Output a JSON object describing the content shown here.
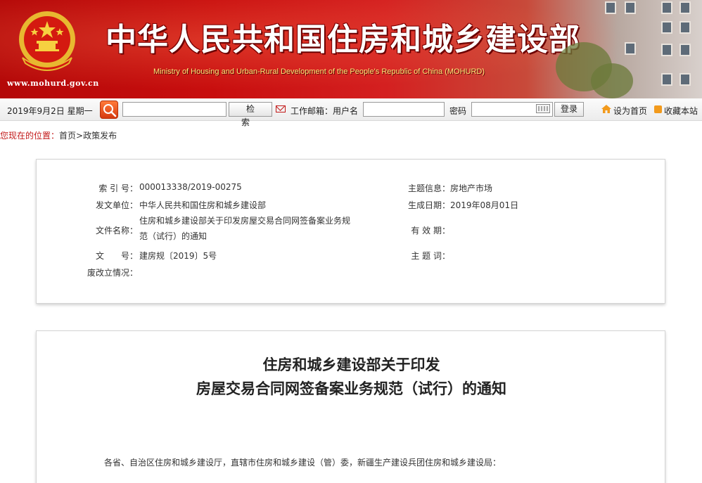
{
  "banner": {
    "cn_title": "中华人民共和国住房和城乡建设部",
    "en_title": "Ministry of Housing and Urban-Rural Development of the People's Republic of China (MOHURD)",
    "site_url": "www.mohurd.gov.cn"
  },
  "toolbar": {
    "date": "2019年9月2日  星期一",
    "search_value": "",
    "search_button": "检索",
    "mail_label": "工作邮箱：用户名",
    "username_value": "",
    "password_label": "密码",
    "password_value": "",
    "login_button": "登录",
    "set_home": "设为首页",
    "add_favorite": "收藏本站"
  },
  "breadcrumb": {
    "label": "您现在的位置：",
    "home": "首页",
    "sep": ">",
    "section": "政策发布"
  },
  "info": {
    "index_label": "索 引 号：",
    "index_value": "000013338/2019-00275",
    "topic_label": "主题信息：",
    "topic_value": "房地产市场",
    "issuer_label": "发文单位：",
    "issuer_value": "中华人民共和国住房和城乡建设部",
    "date_label": "生成日期：",
    "date_value": "2019年08月01日",
    "doc_name_label": "文件名称：",
    "doc_name_value": "住房和城乡建设部关于印发房屋交易合同网签备案业务规范（试行）的通知",
    "validity_label": "有 效 期：",
    "validity_value": "",
    "doc_no_label": "文　　号：",
    "doc_no_value": "建房规〔2019〕5号",
    "keywords_label": "主 题 词：",
    "keywords_value": "",
    "status_label": "废改立情况：",
    "status_value": ""
  },
  "article": {
    "title_line1": "住房和城乡建设部关于印发",
    "title_line2": "房屋交易合同网签备案业务规范（试行）的通知",
    "salutation": "各省、自治区住房和城乡建设厅，直辖市住房和城乡建设（管）委，新疆生产建设兵团住房和城乡建设局："
  }
}
